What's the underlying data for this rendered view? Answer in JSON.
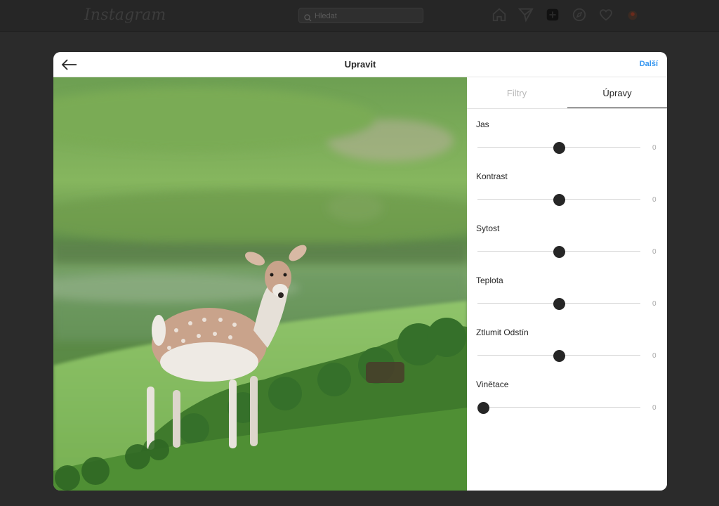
{
  "header": {
    "logo": "Instagram",
    "search_placeholder": "Hledat"
  },
  "modal": {
    "title": "Upravit",
    "next_label": "Další"
  },
  "tabs": {
    "filters": "Filtry",
    "adjustments": "Úpravy",
    "active": "adjustments"
  },
  "adjustments": [
    {
      "label": "Jas",
      "value": "0",
      "level": 0.5
    },
    {
      "label": "Kontrast",
      "value": "0",
      "level": 0.5
    },
    {
      "label": "Sytost",
      "value": "0",
      "level": 0.5
    },
    {
      "label": "Teplota",
      "value": "0",
      "level": 0.5
    },
    {
      "label": "Ztlumit Odstín",
      "value": "0",
      "level": 0.5
    },
    {
      "label": "Vinětace",
      "value": "0",
      "level": 0.0
    }
  ],
  "colors": {
    "accent": "#3897f0",
    "text": "#262626",
    "muted": "#b8b8b8"
  }
}
